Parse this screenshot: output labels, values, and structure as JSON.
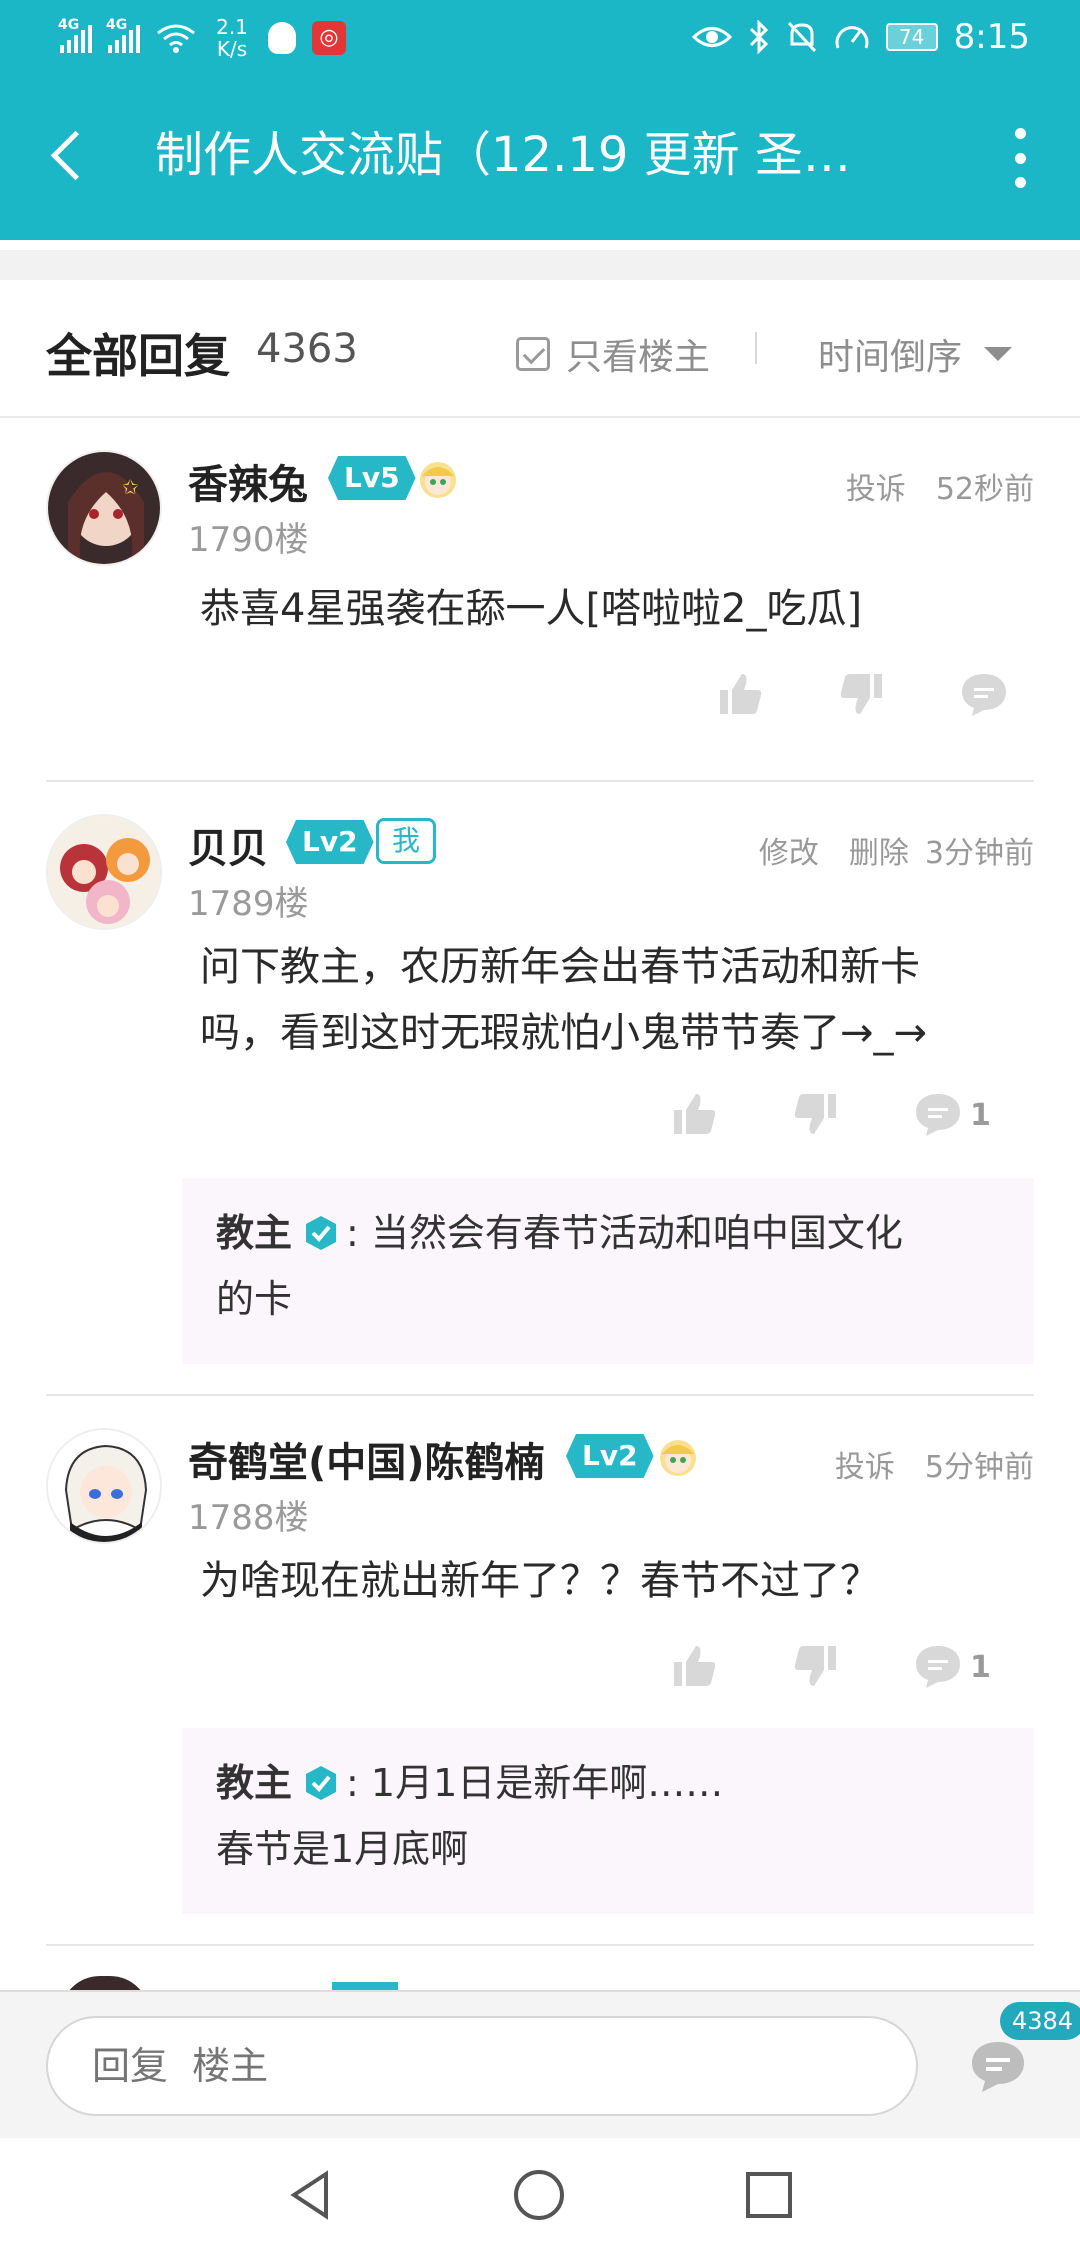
{
  "status_bar": {
    "network_left": "4G",
    "network_right": "4G",
    "speed_value": "2.1",
    "speed_unit": "K/s",
    "netease_icon": "netease-music-icon",
    "battery": "74",
    "time": "8:15"
  },
  "app_bar": {
    "title": "制作人交流贴（12.19 更新  圣…"
  },
  "filter": {
    "heading": "全部回复",
    "count": "4363",
    "only_op_label": "只看楼主",
    "sort_label": "时间倒序"
  },
  "replies": [
    {
      "name": "香辣兔",
      "level": "Lv5",
      "floor": "1790楼",
      "actions": [
        "投诉"
      ],
      "time": "52秒前",
      "content": "恭喜4星强袭在舔一人[嗒啦啦2_吃瓜]",
      "comment_count": ""
    },
    {
      "name": "贝贝",
      "level": "Lv2",
      "me_tag": "我",
      "floor": "1789楼",
      "actions": [
        "修改",
        "删除"
      ],
      "time": "3分钟前",
      "content_line1": "问下教主，农历新年会出春节活动和新卡",
      "content_line2": "吗，看到这时无瑕就怕小鬼带节奏了→_→",
      "comment_count": "1",
      "sub_reply": {
        "author": "教主",
        "text_line1": ": 当然会有春节活动和咱中国文化",
        "text_line2": "的卡"
      }
    },
    {
      "name": "奇鹤堂(中国)陈鹤楠",
      "level": "Lv2",
      "floor": "1788楼",
      "actions": [
        "投诉"
      ],
      "time": "5分钟前",
      "content": "为啥现在就出新年了？？春节不过了？",
      "comment_count": "1",
      "sub_reply": {
        "author": "教主",
        "text_line1": ": 1月1日是新年啊……",
        "text_line2": "春节是1月底啊"
      }
    }
  ],
  "input_bar": {
    "placeholder": "回复  楼主",
    "badge": "4384"
  },
  "colors": {
    "brand": "#1bb7c7",
    "level_badge": "#27b8c8",
    "sub_reply_bg": "#fbf6fb"
  }
}
